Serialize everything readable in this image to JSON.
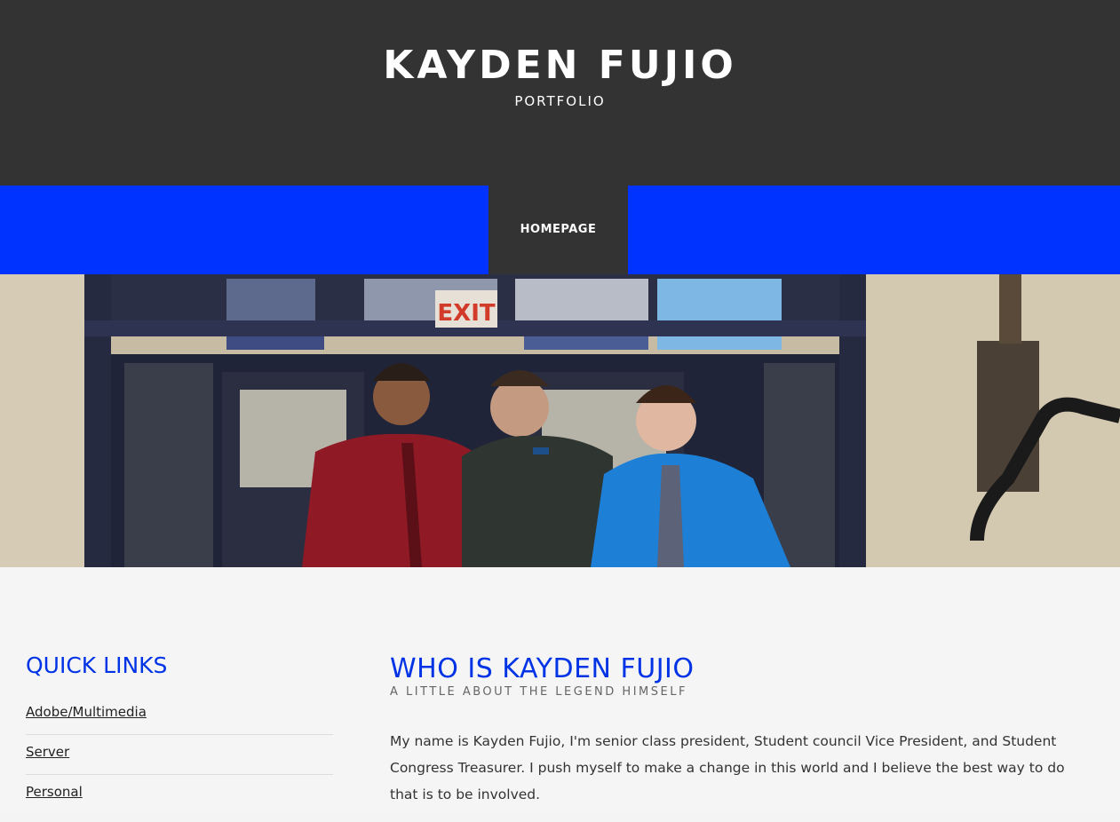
{
  "header": {
    "title": "KAYDEN FUJIO",
    "tagline": "PORTFOLIO"
  },
  "nav": {
    "items": [
      {
        "label": "HOMEPAGE"
      }
    ]
  },
  "hero": {
    "exit_sign": "EXIT"
  },
  "sidebar": {
    "title": "QUICK LINKS",
    "links": [
      {
        "label": "Adobe/Multimedia"
      },
      {
        "label": "Server"
      },
      {
        "label": "Personal"
      }
    ]
  },
  "main": {
    "title": "WHO IS KAYDEN FUJIO",
    "subtitle": "A LITTLE ABOUT THE LEGEND HIMSELF",
    "body": "My name is Kayden Fujio, I'm senior class president, Student council Vice President, and Student Congress Treasurer. I push myself to make a change in this world and I believe the best way to do that is to be involved."
  },
  "colors": {
    "header_bg": "#333333",
    "nav_bg": "#0033ff",
    "accent": "#0033e6"
  }
}
